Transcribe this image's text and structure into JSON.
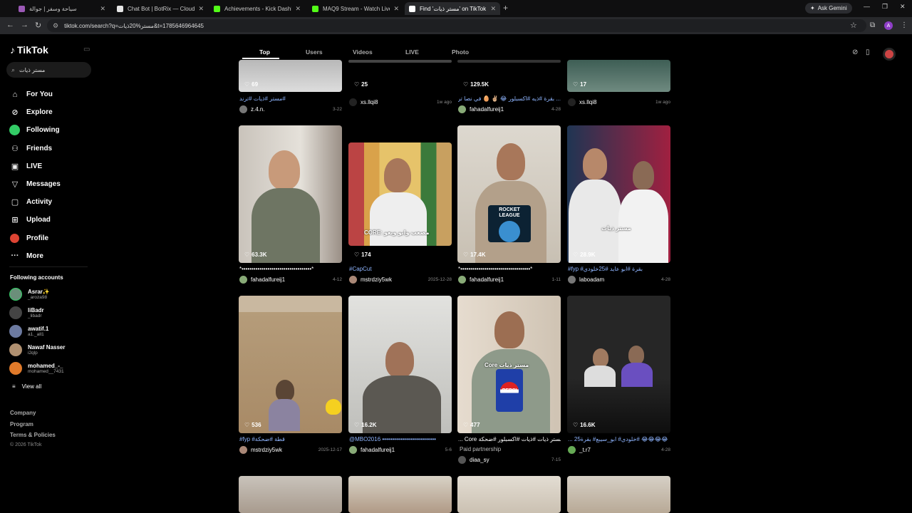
{
  "browser": {
    "tabs": [
      {
        "label": "سياحة وسفر | جوالة",
        "fav_color": "#9b59b6"
      },
      {
        "label": "Chat Bot | BotRix — Cloud Stre",
        "fav_color": "#e6e6e6"
      },
      {
        "label": "Achievements - Kick Dashboard",
        "fav_color": "#53fc18"
      },
      {
        "label": "MAQ9 Stream - Watch Live on K",
        "fav_color": "#53fc18"
      },
      {
        "label": "Find 'مستر ذيات' on TikTok",
        "fav_color": "#ffffff"
      }
    ],
    "ask_gemini": "Ask Gemini",
    "url": "tiktok.com/search?q=مستر%20ذيات&t=1785646964645",
    "profile_initial": "A"
  },
  "sidebar": {
    "logo": "TikTok",
    "search_value": "مستر ذيات",
    "nav": [
      {
        "label": "For You",
        "icon": "home-icon",
        "glyph": "⌂"
      },
      {
        "label": "Explore",
        "icon": "compass-icon",
        "glyph": "⊘"
      },
      {
        "label": "Following",
        "icon": "avatar-icon",
        "glyph": ""
      },
      {
        "label": "Friends",
        "icon": "friends-icon",
        "glyph": "⚇"
      },
      {
        "label": "LIVE",
        "icon": "live-icon",
        "glyph": "▣"
      },
      {
        "label": "Messages",
        "icon": "messages-icon",
        "glyph": "▽"
      },
      {
        "label": "Activity",
        "icon": "activity-icon",
        "glyph": "▢"
      },
      {
        "label": "Upload",
        "icon": "upload-icon",
        "glyph": "⊞"
      },
      {
        "label": "Profile",
        "icon": "profile-icon",
        "glyph": ""
      },
      {
        "label": "More",
        "icon": "more-icon",
        "glyph": "···"
      }
    ],
    "following_title": "Following accounts",
    "following": [
      {
        "name": "Asrar✨",
        "handle": "_aroza98",
        "color": "#6b8f7a"
      },
      {
        "name": "liBadr",
        "handle": "_libadr",
        "color": "#444"
      },
      {
        "name": "awatif.1",
        "handle": "a1._all1",
        "color": "#6c7aa0"
      },
      {
        "name": "Nawaf Nasser",
        "handle": "i2qlp",
        "color": "#b09070"
      },
      {
        "name": "mohamed_-_",
        "handle": "mohamed__7431",
        "color": "#e07a2a"
      }
    ],
    "view_all": "View all",
    "footer": [
      "Company",
      "Program",
      "Terms & Policies"
    ],
    "copyright": "© 2026 TikTok"
  },
  "search_tabs": [
    "Top",
    "Users",
    "Videos",
    "LIVE",
    "Photo"
  ],
  "videos": [
    {
      "likes": "69",
      "caption": "#مستر #ذيات #ترند",
      "user": "z.4.n.",
      "date": "3-22",
      "av": "#777"
    },
    {
      "likes": "25",
      "caption": "",
      "user": "xs.llqi8",
      "date": "1w ago",
      "av": "#222"
    },
    {
      "likes": "129.5K",
      "caption": "... بقرة #ذيه #اكسبلور 😂 ✌🏼 🥚 في نصا ترجي",
      "user": "fahadalfureij1",
      "date": "4-28",
      "av": "#8a7"
    },
    {
      "likes": "17",
      "caption": "",
      "user": "xs.llqi8",
      "date": "1w ago",
      "av": "#222"
    },
    {
      "likes": "63.3K",
      "caption": "*•••••••••••••••••••••••••••••••••••*",
      "user": "fahadalfureij1",
      "date": "4-12",
      "av": "#8a7"
    },
    {
      "likes": "174",
      "caption": "#CapCut",
      "user": "mstrdziy5wk",
      "date": "2025-12-28",
      "av": "#a87"
    },
    {
      "likes": "17.4K",
      "caption": "*•••••••••••••••••••••••••••••••••••*",
      "user": "fahadalfureij1",
      "date": "1-11",
      "av": "#8a7"
    },
    {
      "likes": "28.9K",
      "caption": "#fyp #بقرة #ابو عايد #25خلودي",
      "user": "laboadam",
      "date": "4-28",
      "av": "#777"
    },
    {
      "likes": "536",
      "caption": "#fyp #قطة #ضحكة",
      "user": "mstrdziy5wk",
      "date": "2025-12-17",
      "av": "#a87"
    },
    {
      "likes": "16.2K",
      "caption": "@MBO2016 •••••••••••••••••••••••••••",
      "user": "fahadalfureij1",
      "date": "5-6",
      "av": "#8a7"
    },
    {
      "likes": "477",
      "caption": "... Core مستر ذيات #ذيات #اكسبلور #ضحكة",
      "user": "diaa_sy",
      "date": "7-15",
      "av": "#555",
      "paid": "Paid partnership"
    },
    {
      "likes": "16.6K",
      "caption": "... 25خلودي# ابو_سيبع# بقرة# 😂😂😂😂",
      "user": "_t.r7",
      "date": "4-28",
      "av": "#6a5"
    }
  ],
  "thumb_text": {
    "rocket_league": "ROCKET LEAGUE",
    "pepsi": "PEPSI",
    "core_pepsi": "Core مستر ذيات",
    "overlay_2": "CORE: مصعب وابو وبعو",
    "overlay_4": "مستر ذيات"
  }
}
